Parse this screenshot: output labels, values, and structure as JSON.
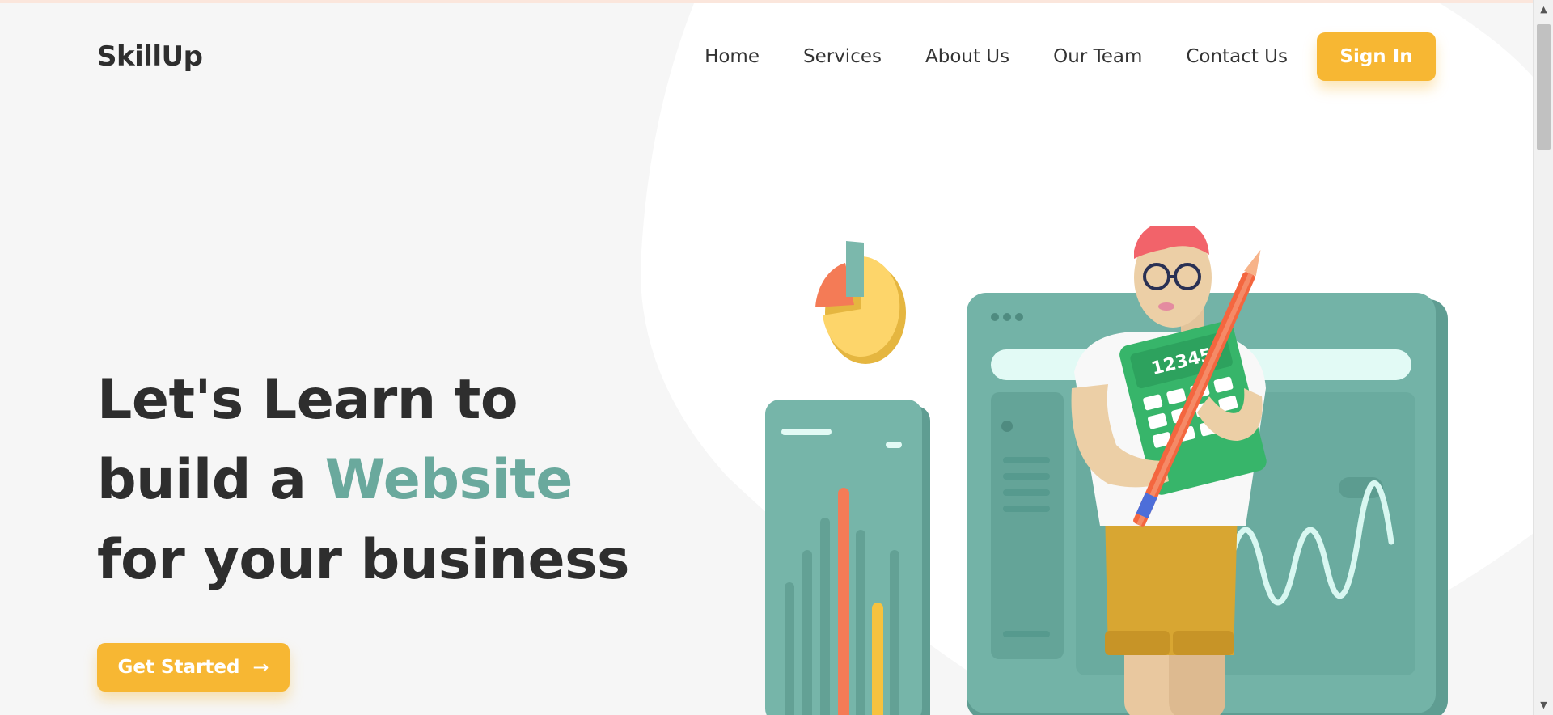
{
  "brand": {
    "name": "SkillUp"
  },
  "nav": {
    "links": [
      "Home",
      "Services",
      "About Us",
      "Our Team",
      "Contact Us"
    ],
    "sign_in_label": "Sign In"
  },
  "hero": {
    "line1": "Let's Learn to",
    "line2_prefix": "build a ",
    "line2_accent": "Website",
    "line3": "for your business",
    "cta_label": "Get Started",
    "cta_icon": "arrow-right-icon"
  },
  "illustration": {
    "calculator_text": "12345"
  },
  "colors": {
    "accent_yellow": "#f7b733",
    "accent_teal": "#6aa99d",
    "text_dark": "#2e2e2e",
    "background": "#f6f6f6"
  }
}
